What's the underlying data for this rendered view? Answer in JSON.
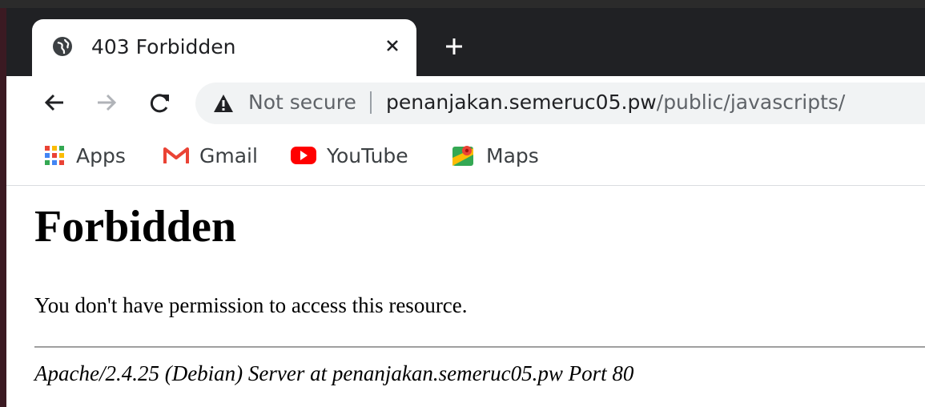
{
  "tab": {
    "title": "403 Forbidden",
    "globe_icon": "globe-icon",
    "close_icon": "close-icon",
    "new_tab_icon": "plus-icon"
  },
  "nav": {
    "back_icon": "arrow-left-icon",
    "forward_icon": "arrow-right-icon",
    "reload_icon": "reload-icon"
  },
  "omnibox": {
    "security_label": "Not secure",
    "security_icon": "warning-triangle-icon",
    "url_host": "penanjakan.semeruc05.pw",
    "url_path": "/public/javascripts/"
  },
  "bookmarks": [
    {
      "label": "Apps",
      "icon": "apps-grid-icon"
    },
    {
      "label": "Gmail",
      "icon": "gmail-icon",
      "color": "#ea4335"
    },
    {
      "label": "YouTube",
      "icon": "youtube-icon",
      "color": "#ff0000"
    },
    {
      "label": "Maps",
      "icon": "maps-icon"
    }
  ],
  "page": {
    "heading": "Forbidden",
    "message": "You don't have permission to access this resource.",
    "server_signature": "Apache/2.4.25 (Debian) Server at penanjakan.semeruc05.pw Port 80"
  }
}
